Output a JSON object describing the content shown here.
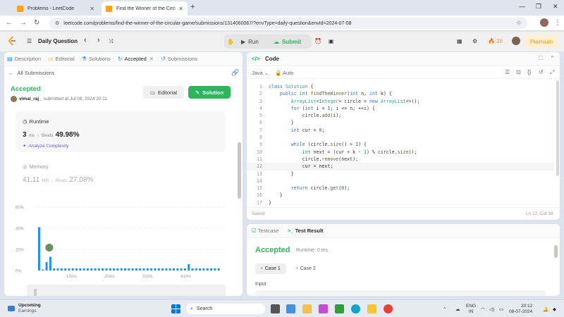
{
  "browser": {
    "tabs": [
      {
        "title": "Problems - LeetCode",
        "active": false
      },
      {
        "title": "Find the Winner of the Circular",
        "active": true
      }
    ],
    "url": "leetcode.com/problems/find-the-winner-of-the-circular-game/submissions/1314060067/?envType=daily-question&envId=2024-07-08"
  },
  "topbar": {
    "daily_question": "Daily Question",
    "run": "Run",
    "submit": "Submit",
    "streak": "38",
    "premium": "Premium"
  },
  "left": {
    "tabs": [
      "Description",
      "Editorial",
      "Solutions",
      "Accepted",
      "Submissions"
    ],
    "all_submissions": "All Submissions",
    "status": "Accepted",
    "user": "vimal_raj_",
    "submitted": "submitted at Jul 08, 2024 20:11",
    "editorial_btn": "Editorial",
    "solution_btn": "Solution",
    "runtime_label": "Runtime",
    "runtime_value": "3",
    "runtime_unit": "ms",
    "beats_label": "Beats",
    "runtime_beats": "49.98%",
    "analyze": "Analyze Complexity",
    "memory_label": "Memory",
    "memory_value": "41.11",
    "memory_unit": "MB",
    "memory_beats": "27.08%"
  },
  "chart_data": {
    "type": "bar",
    "ylim": [
      0,
      60
    ],
    "yticks": [
      "60%",
      "40%",
      "20%",
      "0%"
    ],
    "xticks": [
      "10ms",
      "20ms",
      "31ms",
      "41ms"
    ],
    "values": [
      41,
      1,
      8,
      13,
      2,
      2,
      2,
      2,
      2,
      2,
      2,
      2,
      2,
      2,
      2,
      2,
      2,
      2,
      2,
      2,
      2,
      2,
      2,
      2,
      2,
      2,
      2,
      2,
      2,
      2,
      2,
      2,
      2,
      2,
      2,
      2,
      2,
      2,
      2,
      2,
      6,
      2,
      2,
      2,
      2,
      2,
      2,
      2,
      2
    ],
    "highlight_index": 3,
    "bar_color": "#1a90ff"
  },
  "code_panel": {
    "title": "Code",
    "language": "Java",
    "auto": "Auto",
    "saved": "Saved",
    "cursor": "Ln 12, Col 16",
    "lines": [
      {
        "n": "1",
        "t": "class Solution {"
      },
      {
        "n": "2",
        "t": "    public int findTheWinner(int n, int k) {"
      },
      {
        "n": "3",
        "t": "        ArrayList<Integer> circle = new ArrayList<>();"
      },
      {
        "n": "4",
        "t": "        for (int i = 1; i <= n; ++i) {"
      },
      {
        "n": "5",
        "t": "            circle.add(i);"
      },
      {
        "n": "6",
        "t": "        }"
      },
      {
        "n": "7",
        "t": "        int cur = 0;"
      },
      {
        "n": "8",
        "t": ""
      },
      {
        "n": "9",
        "t": "        while (circle.size() > 1) {"
      },
      {
        "n": "10",
        "t": "            int next = (cur + k - 1) % circle.size();"
      },
      {
        "n": "11",
        "t": "            circle.remove(next);"
      },
      {
        "n": "12",
        "t": "            cur = next;"
      },
      {
        "n": "13",
        "t": "        }"
      },
      {
        "n": "14",
        "t": ""
      },
      {
        "n": "15",
        "t": "        return circle.get(0);"
      },
      {
        "n": "16",
        "t": "    }"
      },
      {
        "n": "17",
        "t": "}"
      }
    ]
  },
  "result_panel": {
    "testcase_tab": "Testcase",
    "result_tab": "Test Result",
    "status": "Accepted",
    "runtime": "Runtime: 0 ms",
    "case1": "Case 1",
    "case2": "Case 2",
    "input_label": "Input"
  },
  "taskbar": {
    "weather_title": "Upcoming",
    "weather_sub": "Earnings",
    "search": "Search",
    "lang1": "ENG",
    "lang2": "IN",
    "time": "20:12",
    "date": "08-07-2024"
  },
  "colors": {
    "accent_green": "#2db55d",
    "orange": "#ffa116",
    "blue": "#1a90ff"
  }
}
